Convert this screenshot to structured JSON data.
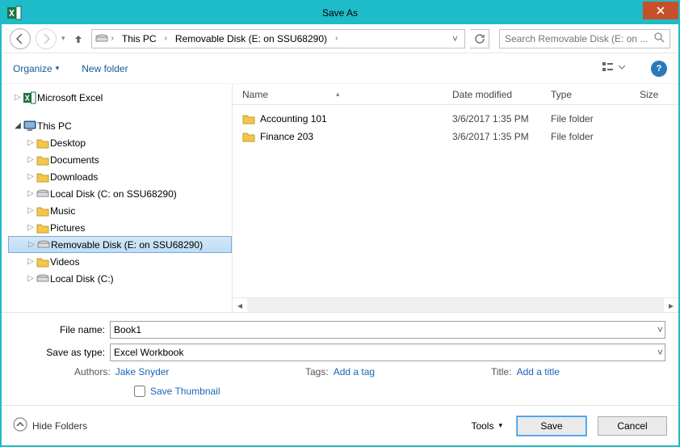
{
  "window": {
    "title": "Save As"
  },
  "breadcrumb": {
    "root": "This PC",
    "current": "Removable Disk (E: on SSU68290)"
  },
  "search": {
    "placeholder": "Search Removable Disk (E: on ..."
  },
  "toolbar": {
    "organize": "Organize",
    "newfolder": "New folder"
  },
  "tree": {
    "excel": "Microsoft Excel",
    "thispc": "This PC",
    "items": [
      {
        "label": "Desktop"
      },
      {
        "label": "Documents"
      },
      {
        "label": "Downloads"
      },
      {
        "label": "Local Disk (C: on SSU68290)"
      },
      {
        "label": "Music"
      },
      {
        "label": "Pictures"
      },
      {
        "label": "Removable Disk (E: on SSU68290)",
        "selected": true
      },
      {
        "label": "Videos"
      },
      {
        "label": "Local Disk (C:)"
      }
    ]
  },
  "columns": {
    "name": "Name",
    "date": "Date modified",
    "type": "Type",
    "size": "Size"
  },
  "files": [
    {
      "name": "Accounting 101",
      "date": "3/6/2017 1:35 PM",
      "type": "File folder"
    },
    {
      "name": "Finance 203",
      "date": "3/6/2017 1:35 PM",
      "type": "File folder"
    }
  ],
  "form": {
    "filename_label": "File name:",
    "filename_value": "Book1",
    "type_label": "Save as type:",
    "type_value": "Excel Workbook",
    "authors_label": "Authors:",
    "authors_value": "Jake Snyder",
    "tags_label": "Tags:",
    "tags_value": "Add a tag",
    "title_label": "Title:",
    "title_value": "Add a title",
    "thumb_label": "Save Thumbnail"
  },
  "footer": {
    "hide": "Hide Folders",
    "tools": "Tools",
    "save": "Save",
    "cancel": "Cancel"
  }
}
